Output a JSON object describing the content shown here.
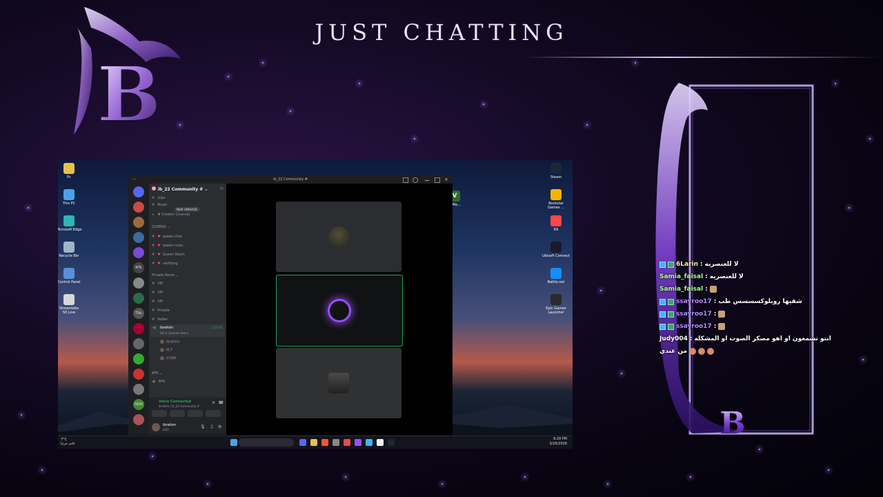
{
  "stream": {
    "title": "JUST CHATTING",
    "logo_letter": "B",
    "frame_letter": "B"
  },
  "desktop": {
    "left_icons": [
      {
        "label": "Pc",
        "color": "#e8c04a",
        "icon": "folder-icon"
      },
      {
        "label": "This PC",
        "color": "#4aa3e8",
        "icon": "monitor-icon"
      },
      {
        "label": "Microsoft Edge",
        "color": "#2fb6b0",
        "icon": "edge-icon"
      },
      {
        "label": "Recycle Bin",
        "color": "#9fb4c8",
        "icon": "recycle-bin-icon"
      },
      {
        "label": "Control Panel",
        "color": "#5a8fd8",
        "icon": "control-panel-icon"
      },
      {
        "label": "Streamlabs SE.Live",
        "color": "#d8d8d8",
        "icon": "streamlabs-icon"
      }
    ],
    "right_icons": [
      {
        "label": "Steam",
        "color": "#1b2838",
        "icon": "steam-icon"
      },
      {
        "label": "Rockstar Games ...",
        "color": "#f5b400",
        "icon": "rockstar-icon"
      },
      {
        "label": "EA",
        "color": "#ff4747",
        "icon": "ea-icon"
      },
      {
        "label": "Ubisoft Connect",
        "color": "#1a1a2a",
        "icon": "ubisoft-icon"
      },
      {
        "label": "Battle.net",
        "color": "#148eff",
        "icon": "battlenet-icon"
      },
      {
        "label": "Epic Games Launcher",
        "color": "#2a2a2a",
        "icon": "epic-icon"
      }
    ],
    "clock_time": "9:29 PM",
    "clock_date": "3/16/2026",
    "weather_text": "7°C",
    "weather_sub": "غائم جزئيا",
    "gta_label": "V_Mo..."
  },
  "discord": {
    "window_title": "ib_22 Community #",
    "server_name": "ib_22 Community #",
    "new_unreads": "NEW UNREADS",
    "top_channels": [
      "clips",
      "Music"
    ],
    "creator_channel": "Creator Channel",
    "category_queens": "QUEENS",
    "queens_channels": [
      "queen-chat",
      "queen-rules",
      "Queen Room",
      "verifying"
    ],
    "category_private": "Private Room",
    "private_channels": [
      "VIP",
      "VIP",
      "VIP",
      "Private",
      "Na9er"
    ],
    "active_voice": "ibrahim",
    "active_voice_time": "2:37:45",
    "active_voice_status": "Set a channel status",
    "voice_members": [
      "ibrahim",
      "M.T",
      "070M"
    ],
    "category_afk": "AFK",
    "afk_channel": "AFK",
    "voice_connected": "Voice Connected",
    "voice_server": "ibrahim / ib_22 Community #",
    "username": "ibrahim",
    "user_tag": "ib22",
    "server_badges": [
      "MTs",
      "TNs",
      "NEW"
    ]
  },
  "chat": {
    "messages": [
      {
        "badges": 2,
        "name": "6Larin",
        "name_color": "#ffe9a8",
        "text": "لا للعنصريه",
        "emotes": 0
      },
      {
        "badges": 0,
        "name": "Samia_faisal",
        "name_color": "#a8ff8e",
        "text": "لا للعنصريه",
        "emotes": 0
      },
      {
        "badges": 0,
        "name": "Samia_faisal",
        "name_color": "#a8ff8e",
        "text": "",
        "emotes": 1
      },
      {
        "badges": 2,
        "name": "ssayroo17",
        "name_color": "#b58cff",
        "text": "شقيها رويلوكسسسس طب",
        "emotes": 0
      },
      {
        "badges": 2,
        "name": "ssayroo17",
        "name_color": "#b58cff",
        "text": "",
        "emotes": 1
      },
      {
        "badges": 2,
        "name": "ssayroo17",
        "name_color": "#b58cff",
        "text": "",
        "emotes": 1
      },
      {
        "badges": 0,
        "name": "Judy004",
        "name_color": "#ffffff",
        "text": "انتو تسمعون او اهو مصكر الصوت او المشكله",
        "emotes": 0
      },
      {
        "badges": 0,
        "name": "",
        "name_color": "#ffffff",
        "text": "من عندي",
        "emotes": 3
      }
    ]
  }
}
